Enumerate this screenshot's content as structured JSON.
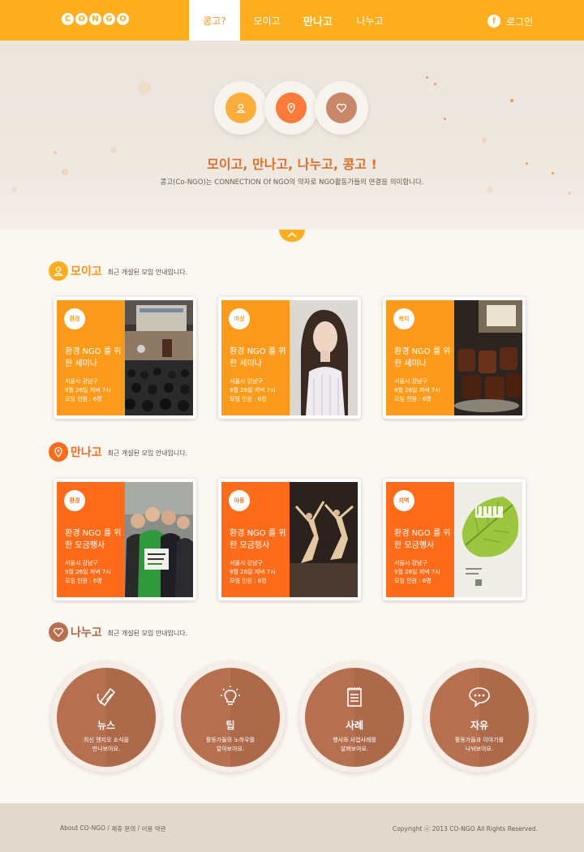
{
  "header": {
    "logo": [
      "C",
      "O",
      "N",
      "G",
      "O"
    ],
    "nav": [
      {
        "label": "콩고?",
        "active": true
      },
      {
        "label": "모이고"
      },
      {
        "label": "만나고",
        "bold": true
      },
      {
        "label": "나누고"
      }
    ],
    "facebook_icon": "f",
    "login_label": "로그인"
  },
  "hero": {
    "icons": [
      "person-icon",
      "location-pin-icon",
      "heart-icon"
    ],
    "title": "모이고, 만나고, 나누고, 콩고 !",
    "subtitle": "콩고(Co-NGO)는 CONNECTION Of NGO의 약자로 NGO활동가들의 연결을 의미합니다."
  },
  "sections": [
    {
      "title": "모이고",
      "desc": "최근 개설된 모임 안내입니다.",
      "color": "#fc9a1b",
      "cards": [
        {
          "tag": "환경",
          "title": "환경 NGO 를 위한 세미나",
          "info": [
            "서울시 강남구",
            "9월 26일 저녁 7시",
            "모임 인원 : 6명"
          ]
        },
        {
          "tag": "여성",
          "title": "환경 NGO 를 위한 세미나",
          "info": [
            "서울시 강남구",
            "9월 26일 저녁 7시",
            "모임 인원 : 6명"
          ]
        },
        {
          "tag": "복지",
          "title": "환경 NGO 를 위한 세미나",
          "info": [
            "서울시 강남구",
            "9월 26일 저녁 7시",
            "모임 인원 : 6명"
          ]
        }
      ]
    },
    {
      "title": "만나고",
      "desc": "최근 개설된 모임 안내입니다.",
      "color": "#fd6c1a",
      "cards": [
        {
          "tag": "환경",
          "title": "환경 NGO 를 위한 모금행사",
          "info": [
            "서울시 강남구",
            "9월 26일 저녁 7시",
            "모임 인원 : 6명"
          ]
        },
        {
          "tag": "아동",
          "title": "환경 NGO 를 위한 모금행사",
          "info": [
            "서울시 강남구",
            "9월 26일 저녁 7시",
            "모임 인원 : 6명"
          ]
        },
        {
          "tag": "지역",
          "title": "환경 NGO 를 위한 모금행사",
          "info": [
            "서울시 강남구",
            "9월 26일 저녁 7시",
            "모임 인원 : 6명"
          ]
        }
      ]
    },
    {
      "title": "나누고",
      "desc": "최근 개설된 모임 안내입니다.",
      "color": "#b6704f"
    }
  ],
  "share": [
    {
      "title": "뉴스",
      "desc": [
        "최신 엔지오 소식을",
        "만나보아요."
      ],
      "icon": "newspaper-icon"
    },
    {
      "title": "팁",
      "desc": [
        "활동가들의 노하우를",
        "알아보아요."
      ],
      "icon": "lightbulb-icon"
    },
    {
      "title": "사례",
      "desc": [
        "행사와 사업사례를",
        "살펴보아요."
      ],
      "icon": "notepad-icon"
    },
    {
      "title": "자유",
      "desc": [
        "활동가들과 이야기를",
        "나눠보아요."
      ],
      "icon": "chat-bubble-icon"
    }
  ],
  "footer": {
    "links": [
      "About CO-NGO",
      "제휴 문의",
      "이용 약관"
    ],
    "separator": " / ",
    "copyright": "Copyright ⓒ 2013 CO-NGO All Rights Reserved."
  }
}
